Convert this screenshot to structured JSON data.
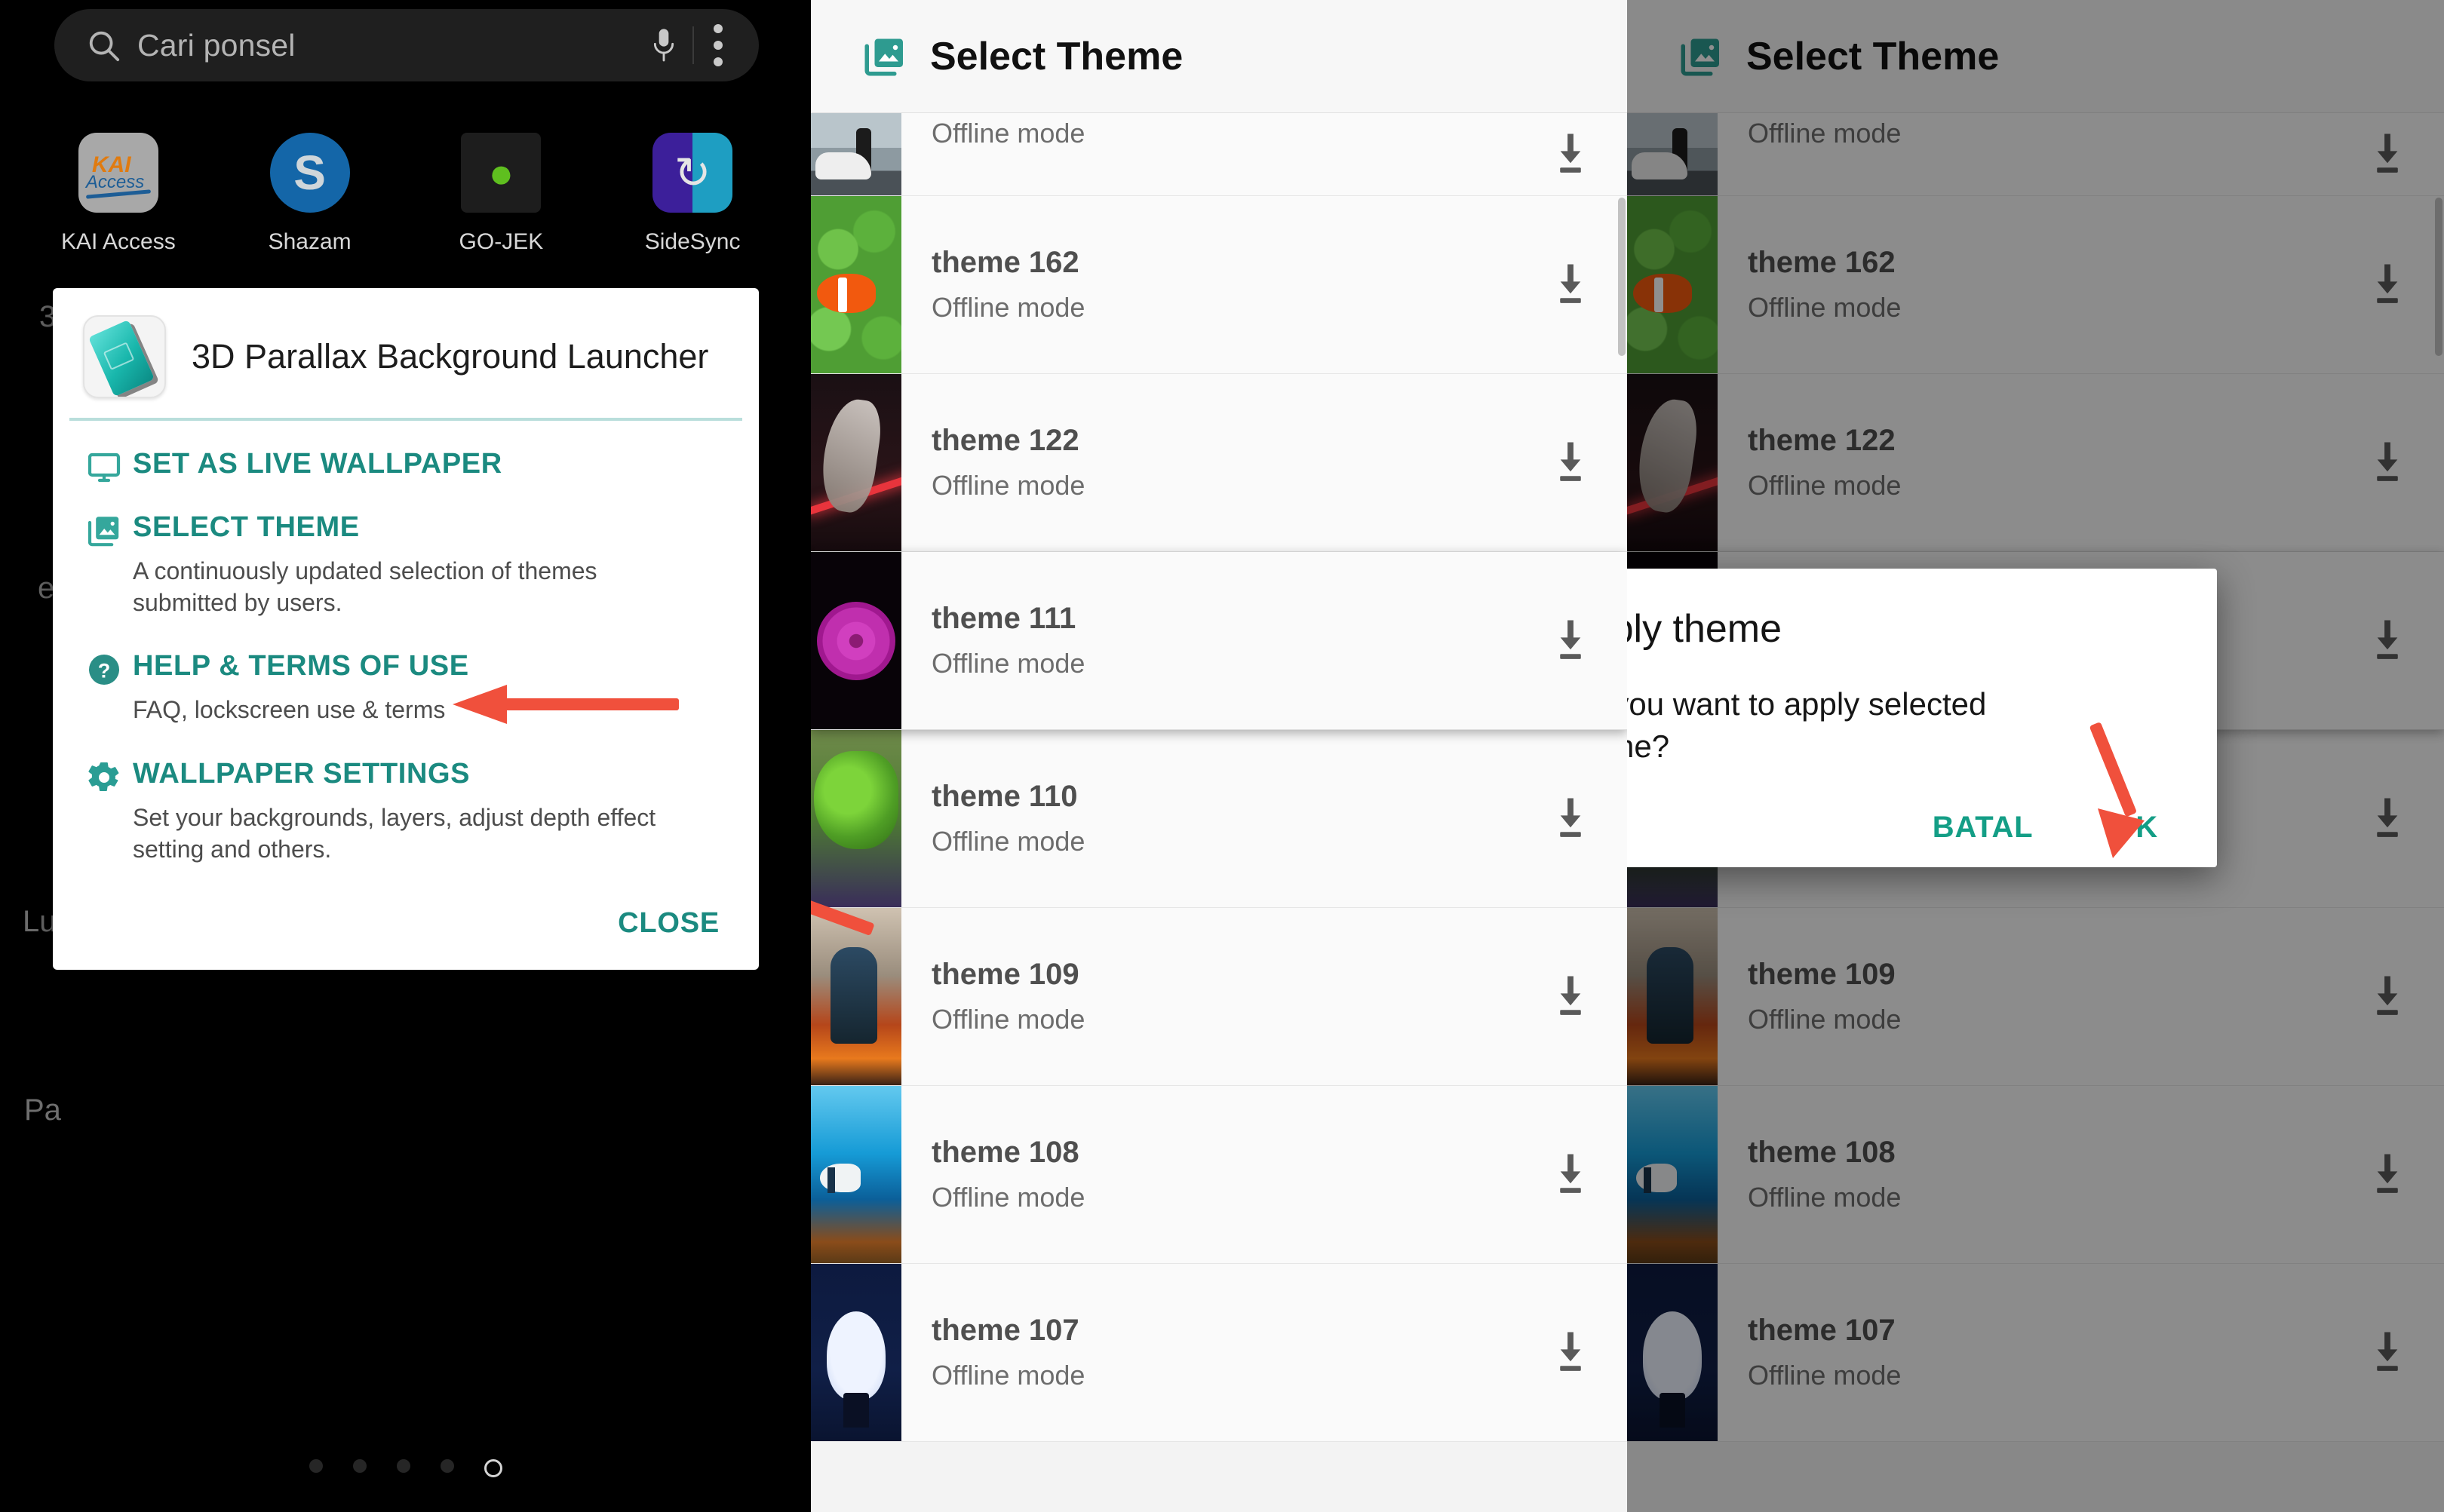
{
  "launcher": {
    "search": {
      "placeholder": "Cari ponsel",
      "icon": "search-icon",
      "mic_icon": "microphone-icon",
      "overflow_icon": "kebab-menu-icon"
    },
    "apps": [
      {
        "label": "KAI Access",
        "icon": "kai-access-app-icon",
        "mark": "KAI",
        "sub": "Access"
      },
      {
        "label": "Shazam",
        "icon": "shazam-app-icon",
        "mark": "S"
      },
      {
        "label": "GO-JEK",
        "icon": "gojek-app-icon",
        "mark": "🏍"
      },
      {
        "label": "SideSync",
        "icon": "sidesync-app-icon",
        "mark": "↻"
      }
    ],
    "page_dots": {
      "count": 5,
      "current_index": 4
    },
    "background_fragments": [
      "3",
      "e",
      "Lu",
      "Pa"
    ]
  },
  "launcher_dialog": {
    "app_title": "3D Parallax Background Launcher",
    "app_icon": "parallax-app-icon",
    "items": [
      {
        "label": "SET AS LIVE WALLPAPER",
        "icon": "monitor-icon",
        "desc": ""
      },
      {
        "label": "SELECT THEME",
        "icon": "photo-library-icon",
        "desc": "A continuously updated selection of themes submitted by users."
      },
      {
        "label": "HELP & TERMS OF USE",
        "icon": "help-circle-icon",
        "desc": "FAQ, lockscreen use & terms"
      },
      {
        "label": "WALLPAPER SETTINGS",
        "icon": "gear-icon",
        "desc": "Set your backgrounds, layers, adjust depth effect setting and others."
      }
    ],
    "close_label": "CLOSE"
  },
  "theme_screen": {
    "title": "Select Theme",
    "title_icon": "photo-library-icon",
    "offline_label": "Offline mode",
    "download_icon": "download-icon",
    "rows": [
      {
        "name": "",
        "sub": "Offline mode",
        "art": "art-car",
        "partial": true,
        "elevated": false
      },
      {
        "name": "theme 162",
        "sub": "Offline mode",
        "art": "art-nemo",
        "partial": false,
        "elevated": false
      },
      {
        "name": "theme 122",
        "sub": "Offline mode",
        "art": "art-bird",
        "partial": false,
        "elevated": false
      },
      {
        "name": "theme 111",
        "sub": "Offline mode",
        "art": "art-flower",
        "partial": false,
        "elevated": true
      },
      {
        "name": "theme 110",
        "sub": "Offline mode",
        "art": "art-hulk",
        "partial": false,
        "elevated": false
      },
      {
        "name": "theme 109",
        "sub": "Offline mode",
        "art": "art-mech",
        "partial": false,
        "elevated": false
      },
      {
        "name": "theme 108",
        "sub": "Offline mode",
        "art": "art-reef",
        "partial": false,
        "elevated": false
      },
      {
        "name": "theme 107",
        "sub": "Offline mode",
        "art": "art-tunnel",
        "partial": false,
        "elevated": false
      }
    ]
  },
  "apply_dialog": {
    "title": "Apply theme",
    "message": "Do you want to apply selected theme?",
    "cancel_label": "BATAL",
    "ok_label": "OK"
  },
  "annotations": {
    "arrow_color": "#f0503c",
    "arrows": [
      {
        "name": "arrow-to-select-theme",
        "points_at": "SELECT THEME"
      },
      {
        "name": "arrow-to-theme-110",
        "points_at": "theme 110"
      },
      {
        "name": "arrow-to-ok-button",
        "points_at": "OK"
      }
    ]
  },
  "colors": {
    "accent_teal": "#1b8a80",
    "dialog_bg": "#ffffff",
    "list_bg": "#fafafa",
    "arrow_red": "#f0503c"
  }
}
